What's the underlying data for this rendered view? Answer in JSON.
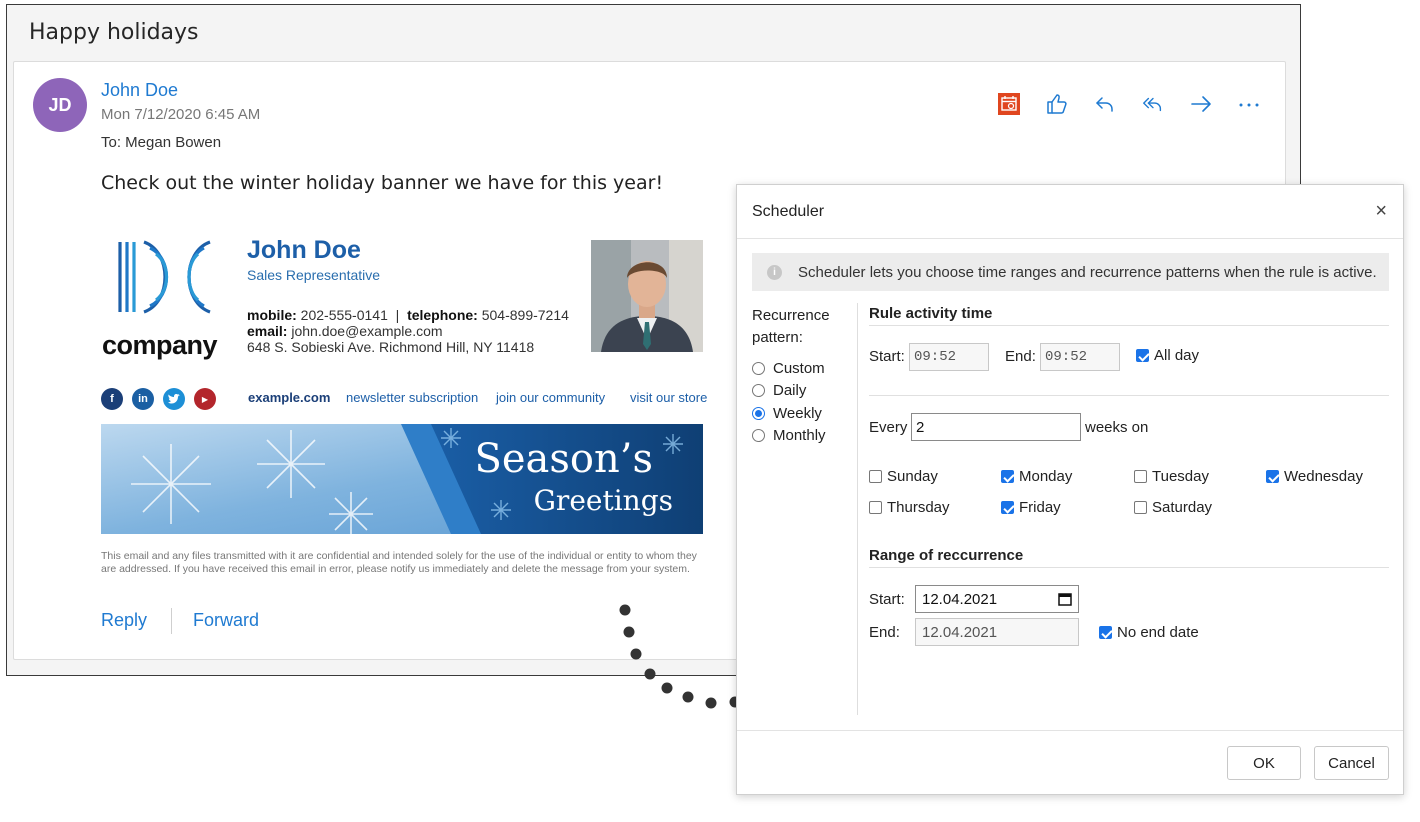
{
  "email": {
    "subject": "Happy holidays",
    "avatar_initials": "JD",
    "sender_name": "John Doe",
    "sent_date": "Mon 7/12/2020 6:45 AM",
    "recipient_line": "To:  Megan Bowen",
    "body_text": "Check out the winter holiday banner we have for this year!",
    "actions": [
      "calendar-scheduler-icon",
      "like-icon",
      "reply-icon",
      "reply-all-icon",
      "forward-icon",
      "more-icon"
    ],
    "reply_label": "Reply",
    "forward_label": "Forward"
  },
  "signature": {
    "logo_text": "company",
    "name": "John Doe",
    "title": "Sales Representative",
    "mobile_label": "mobile:",
    "mobile": "202-555-0141",
    "separator": "|",
    "telephone_label": "telephone:",
    "telephone": "504-899-7214",
    "email_label": "email:",
    "email": "john.doe@example.com",
    "address": "648 S. Sobieski Ave. Richmond Hill, NY 11418",
    "social": [
      "facebook-icon",
      "linkedin-icon",
      "twitter-icon",
      "youtube-icon"
    ],
    "links": {
      "website": "example.com",
      "newsletter": "newsletter subscription",
      "community": "join our community",
      "store": "visit our store"
    },
    "banner_line1": "Season’s",
    "banner_line2": "Greetings",
    "disclaimer": "This email and any files transmitted with it are confidential and intended solely for the use of the individual or entity to whom they are addressed. If you have received this email in error, please notify us immediately and delete the message from your system."
  },
  "scheduler": {
    "title": "Scheduler",
    "close_glyph": "×",
    "info_text": "Scheduler lets you choose time ranges and recurrence patterns when the rule is active.",
    "recurrence_label": "Recurrence pattern:",
    "patterns": [
      "Custom",
      "Daily",
      "Weekly",
      "Monthly"
    ],
    "selected_pattern": "Weekly",
    "rule_activity": {
      "heading": "Rule activity time",
      "start_label": "Start:",
      "start_value": "09:52",
      "end_label": "End:",
      "end_value": "09:52",
      "all_day_label": "All day",
      "all_day": true
    },
    "every_label": "Every",
    "every_value": "2",
    "weeks_on_label": "weeks on",
    "days": [
      {
        "label": "Sunday",
        "checked": false
      },
      {
        "label": "Monday",
        "checked": true
      },
      {
        "label": "Tuesday",
        "checked": false
      },
      {
        "label": "Wednesday",
        "checked": true
      },
      {
        "label": "Thursday",
        "checked": false
      },
      {
        "label": "Friday",
        "checked": true
      },
      {
        "label": "Saturday",
        "checked": false
      }
    ],
    "range": {
      "heading": "Range of reccurrence",
      "start_label": "Start:",
      "start_value": "12.04.2021",
      "end_label": "End:",
      "end_value": "12.04.2021",
      "no_end_label": "No end date",
      "no_end": true
    },
    "ok_label": "OK",
    "cancel_label": "Cancel"
  },
  "colors": {
    "accent_blue": "#1f7ad1",
    "avatar_purple": "#8e65b9",
    "checkbox_blue": "#1a73e8",
    "calendar_icon_orange": "#e0461f"
  }
}
